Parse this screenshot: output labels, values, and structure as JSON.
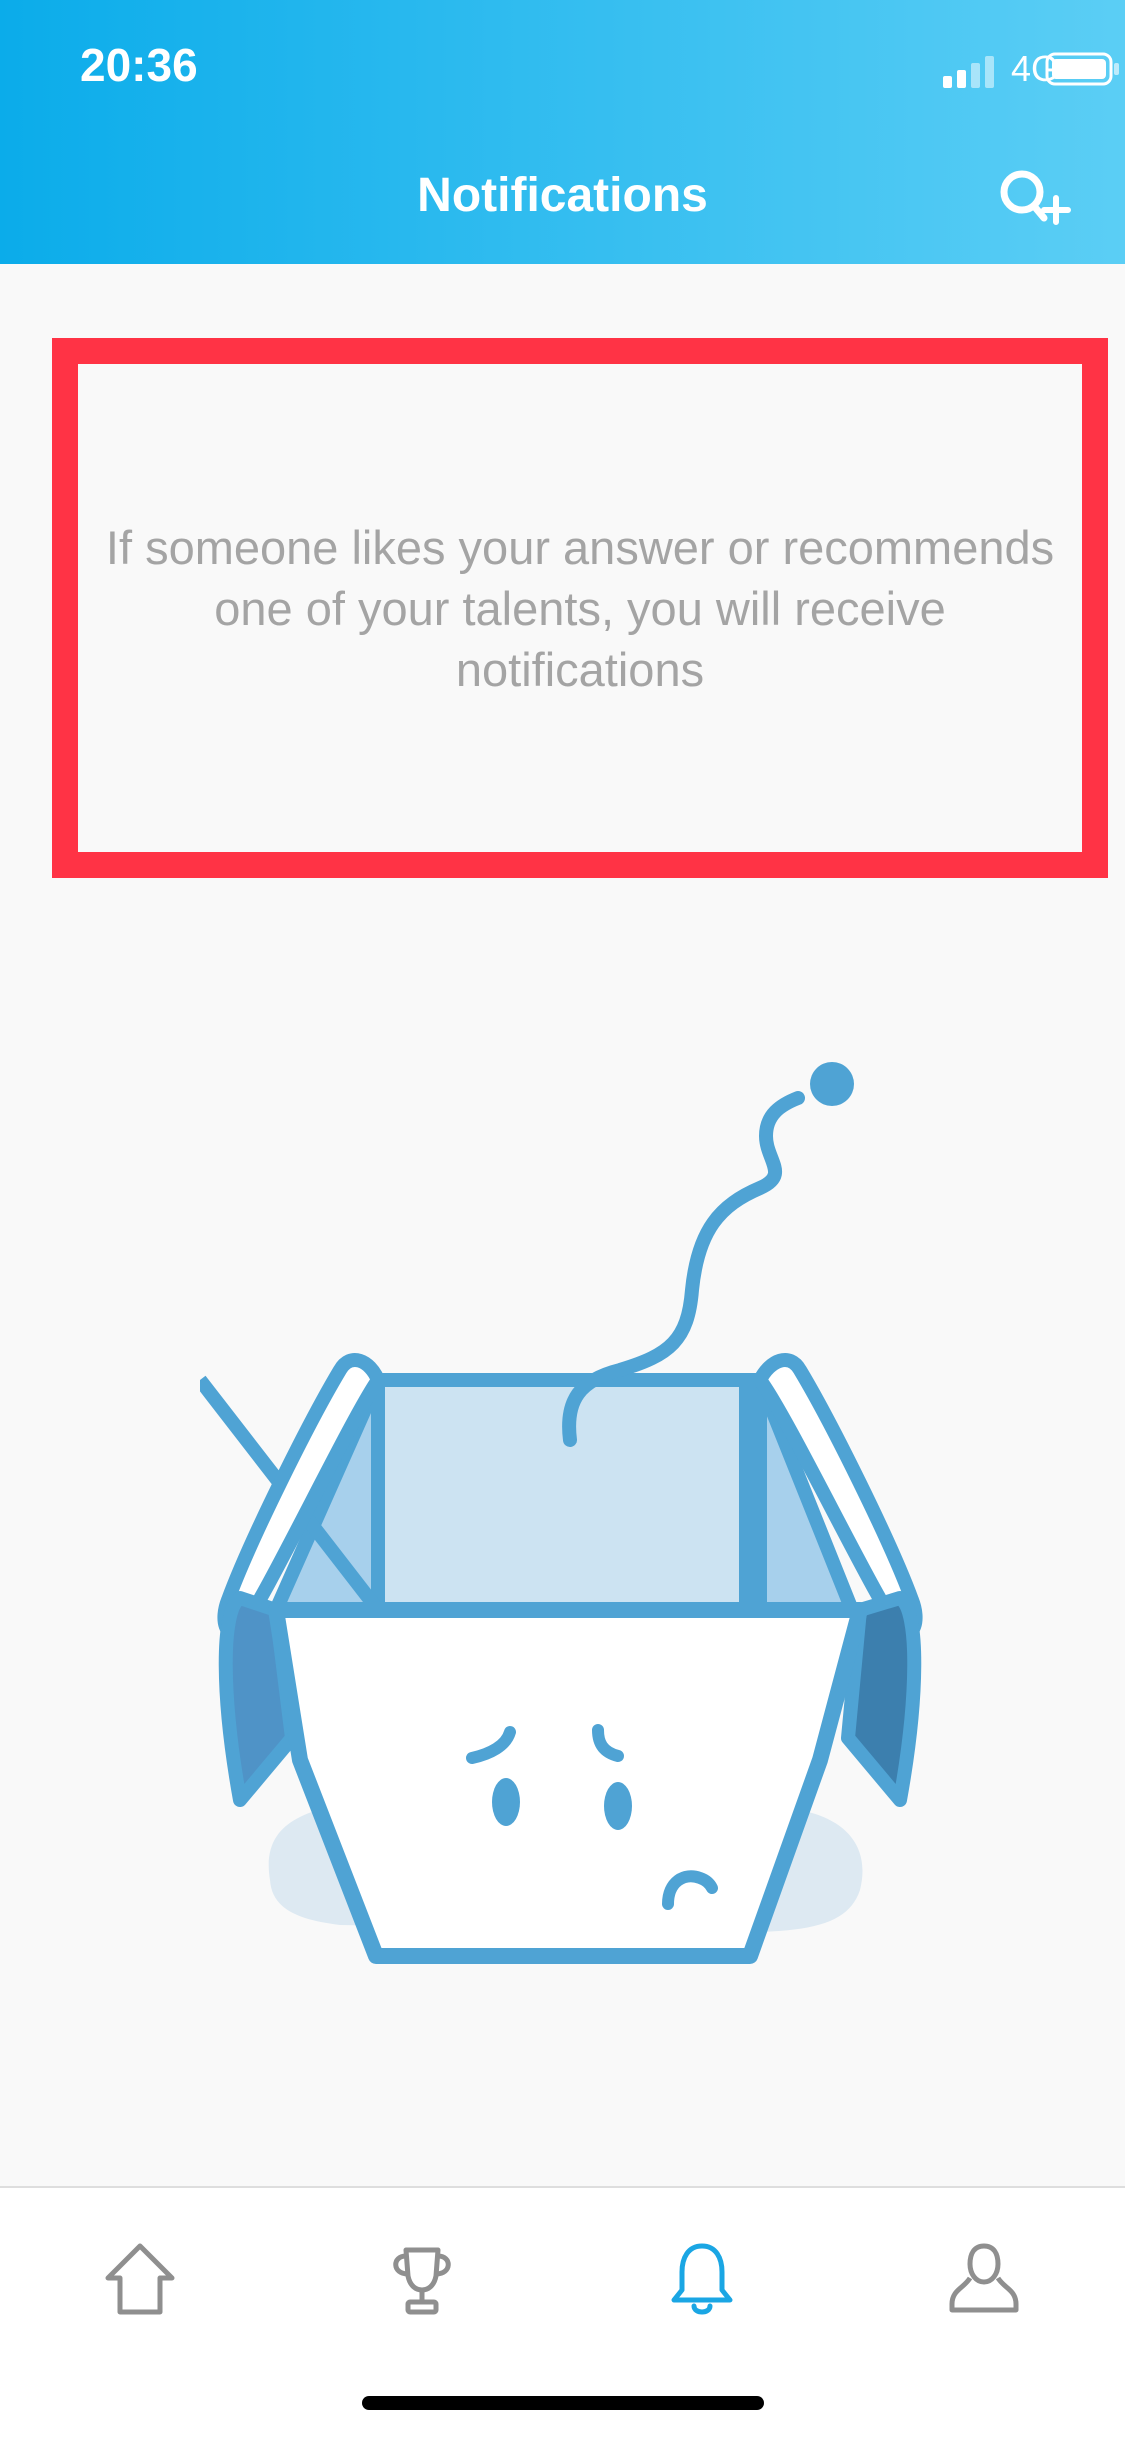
{
  "status_bar": {
    "time": "20:36",
    "network": "4G"
  },
  "header": {
    "title": "Notifications",
    "add_friend_icon": "add-friend-icon"
  },
  "empty_state": {
    "message": "If someone likes your answer or recommends one of your talents, you will receive notifications",
    "illustration": "sad-open-box"
  },
  "tabbar": {
    "tabs": [
      {
        "icon": "home-icon",
        "active": false
      },
      {
        "icon": "trophy-icon",
        "active": false
      },
      {
        "icon": "bell-icon",
        "active": true
      },
      {
        "icon": "profile-icon",
        "active": false
      }
    ]
  },
  "colors": {
    "header_gradient_start": "#0bacea",
    "header_gradient_end": "#5bcef5",
    "highlight_border": "#ff3345",
    "active_tab": "#1aa6e4",
    "inactive_tab": "#8f8f8f",
    "illustration_blue": "#4fa3d4"
  }
}
